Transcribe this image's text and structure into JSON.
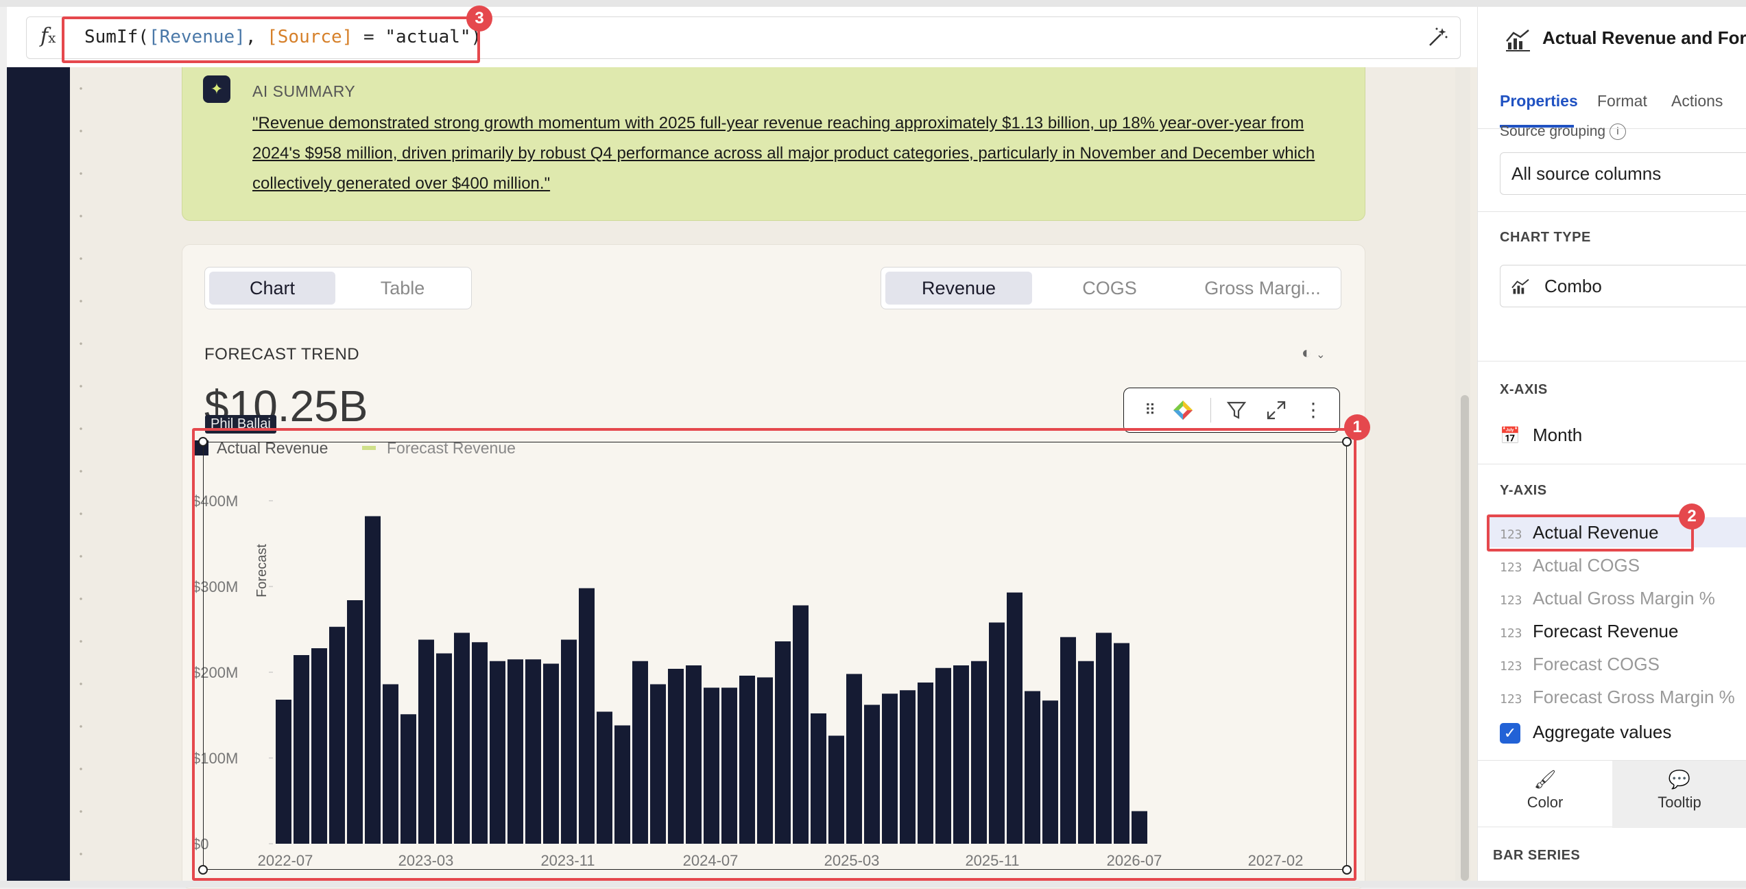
{
  "formula": {
    "fn": "SumIf(",
    "arg1": "[Revenue]",
    "comma": ", ",
    "arg2": "[Source]",
    "rest": " = \"actual\")"
  },
  "ai_summary": {
    "title": "AI SUMMARY",
    "text": "\"Revenue demonstrated strong growth momentum with 2025 full-year revenue reaching approximately $1.13 billion, up 18% year-over-year from 2024's $958 million, driven primarily by robust Q4 performance across all major product categories, particularly in November and December which collectively generated over $400 million.\""
  },
  "view_toggle": {
    "chart": "Chart",
    "table": "Table"
  },
  "metric_tabs": {
    "revenue": "Revenue",
    "cogs": "COGS",
    "gross_margin": "Gross Margi..."
  },
  "forecast_label": "FORECAST TREND",
  "big_number": "$10.25B",
  "user_tag": "Phil Ballai",
  "badges": {
    "b1": "1",
    "b2": "2",
    "b3": "3"
  },
  "colors": {
    "bar": "#151b33",
    "forecast": "#cfe08a",
    "accent": "#2052c2",
    "annotation": "#e5484d"
  },
  "chart_data": {
    "type": "bar",
    "legend": [
      "Actual Revenue",
      "Forecast Revenue"
    ],
    "ylabel": "Forecast",
    "y_ticks": [
      "$0",
      "$100M",
      "$200M",
      "$300M",
      "$400M"
    ],
    "ylim": [
      0,
      400
    ],
    "x_ticks": [
      "2022-07",
      "2023-03",
      "2023-11",
      "2024-07",
      "2025-03",
      "2025-11",
      "2026-07",
      "2027-02"
    ],
    "series": [
      {
        "name": "Actual Revenue",
        "values": [
          168,
          220,
          228,
          253,
          284,
          382,
          186,
          151,
          238,
          222,
          246,
          235,
          213,
          215,
          215,
          210,
          238,
          298,
          154,
          138,
          213,
          186,
          204,
          208,
          182,
          182,
          196,
          194,
          236,
          278,
          152,
          126,
          198,
          162,
          175,
          179,
          188,
          205,
          208,
          213,
          258,
          293,
          178,
          167,
          241,
          213,
          246,
          234,
          38
        ]
      }
    ]
  },
  "panel": {
    "title": "Actual Revenue and Forecast",
    "tabs": {
      "properties": "Properties",
      "format": "Format",
      "actions": "Actions"
    },
    "source_grouping_label": "Source grouping",
    "source_grouping_value": "All source columns",
    "chart_type_label": "CHART TYPE",
    "chart_type_value": "Combo",
    "x_axis_label": "X-AXIS",
    "x_axis_value": "Month",
    "y_axis_label": "Y-AXIS",
    "y_fields": [
      {
        "num": "123",
        "name": "Actual Revenue"
      },
      {
        "num": "123",
        "name": "Actual COGS"
      },
      {
        "num": "123",
        "name": "Actual Gross Margin %"
      },
      {
        "num": "123",
        "name": "Forecast Revenue"
      },
      {
        "num": "123",
        "name": "Forecast COGS"
      },
      {
        "num": "123",
        "name": "Forecast Gross Margin %"
      }
    ],
    "aggregate_label": "Aggregate values",
    "color_tab": "Color",
    "tooltip_tab": "Tooltip",
    "bar_series_label": "BAR SERIES"
  }
}
